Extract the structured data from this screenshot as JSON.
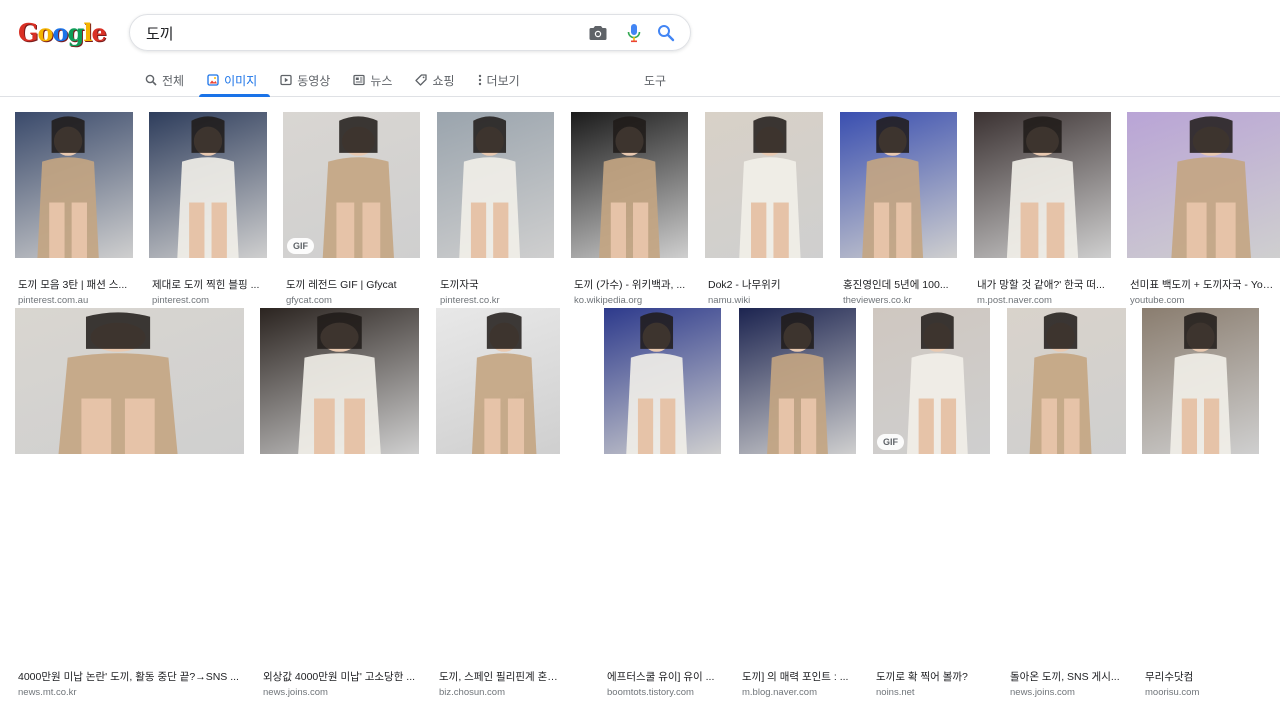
{
  "logo": {
    "letters": [
      "G",
      "o",
      "o",
      "g",
      "l",
      "e"
    ],
    "colors": [
      "#d93025",
      "#f4b400",
      "#1a73e8",
      "#0f9d58",
      "#f4b400",
      "#d93025"
    ]
  },
  "search": {
    "query": "도끼"
  },
  "tabs": [
    {
      "label": "전체",
      "icon": "search-icon"
    },
    {
      "label": "이미지",
      "icon": "image-icon",
      "active": true
    },
    {
      "label": "동영상",
      "icon": "video-icon"
    },
    {
      "label": "뉴스",
      "icon": "news-icon"
    },
    {
      "label": "쇼핑",
      "icon": "tag-icon"
    },
    {
      "label": "더보기",
      "icon": "more-icon"
    }
  ],
  "tools_label": "도구",
  "row1": [
    {
      "title": "도끼 모음 3탄 | 패션 스...",
      "source": "pinterest.com.au",
      "bg": "#3a4a6b"
    },
    {
      "title": "제대로 도끼 찍힌 블핑 ...",
      "source": "pinterest.com",
      "bg": "#2e3d5c"
    },
    {
      "title": "도끼 레전드 GIF | Gfycat",
      "source": "gfycat.com",
      "bg": "#d9d6d2",
      "gif": "GIF"
    },
    {
      "title": "도끼자국",
      "source": "pinterest.co.kr",
      "bg": "#9aa4ad"
    },
    {
      "title": "도끼 (가수) - 위키백과, ...",
      "source": "ko.wikipedia.org",
      "bg": "#1b1b1b"
    },
    {
      "title": "Dok2 - 나무위키",
      "source": "namu.wiki",
      "bg": "#d8d1c7"
    },
    {
      "title": "홍진영인데 5년에 100...",
      "source": "theviewers.co.kr",
      "bg": "#3a4fb0"
    },
    {
      "title": "내가 망할 것 같애?' 한국 떠...",
      "source": "m.post.naver.com",
      "bg": "#3b3232"
    },
    {
      "title": "선미표 백도끼 + 도끼자국 - YouTube",
      "source": "youtube.com",
      "bg": "#b9a4d6"
    }
  ],
  "row2": [
    {
      "title": "4000만원 미납 논란' 도끼, 활동 중단 끝?→SNS ...",
      "source": "news.mt.co.kr",
      "bg": "#d9d6d0"
    },
    {
      "title": "외상값 4000만원 미납' 고소당한 ...",
      "source": "news.joins.com",
      "bg": "#2b2420"
    },
    {
      "title": "도끼, 스페인 필리핀계 혼혈...사...",
      "source": "biz.chosun.com",
      "bg": "#e8e8e8"
    },
    {
      "title": "에프터스쿨 유이] 유이 ...",
      "source": "boomtots.tistory.com",
      "bg": "#2d3a8c"
    },
    {
      "title": "도끼] 의 매력 포인트 : ...",
      "source": "m.blog.naver.com",
      "bg": "#1c2450"
    },
    {
      "title": "도끼로 확 찍어 볼까?",
      "source": "noins.net",
      "bg": "#cfc7c0",
      "gif": "GIF"
    },
    {
      "title": "돌아온 도끼, SNS 게시...",
      "source": "news.joins.com",
      "bg": "#d9d3cb"
    },
    {
      "title": "무리수닷컴",
      "source": "moorisu.com",
      "bg": "#8a7d6f"
    }
  ],
  "icons": {
    "camera": "camera-icon",
    "mic": "mic-icon",
    "search": "search-icon"
  },
  "colors": {
    "accent": "#1a73e8",
    "muted": "#5f6368",
    "border": "#dfe1e5"
  }
}
